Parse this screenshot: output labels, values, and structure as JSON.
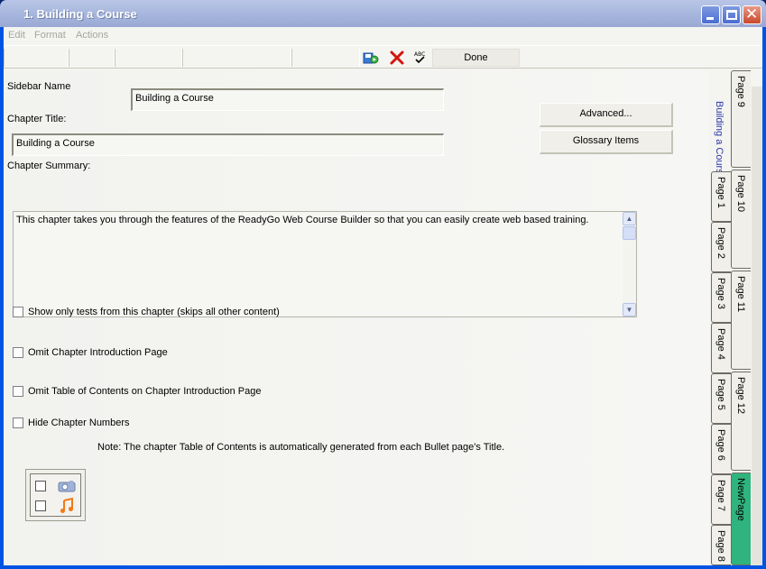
{
  "window": {
    "title": "1. Building a Course"
  },
  "menu": [
    "Edit",
    "Format",
    "Actions"
  ],
  "toolbar": {
    "done_label": "Done",
    "icons": [
      "save-run-icon",
      "delete-icon",
      "spell-check-icon"
    ]
  },
  "form": {
    "sidebar_name_label": "Sidebar Name",
    "sidebar_name_value": "Building a Course",
    "chapter_title_label": "Chapter Title:",
    "chapter_title_value": "Building a Course",
    "chapter_summary_label": "Chapter Summary:",
    "chapter_summary_value": "This chapter takes you through the features of the ReadyGo Web Course Builder so that you can easily create web based training.",
    "advanced_label": "Advanced...",
    "glossary_label": "Glossary Items"
  },
  "options": [
    {
      "label": "Show only tests from this chapter (skips all other content)",
      "checked": false
    },
    {
      "label": "Omit Chapter Introduction Page",
      "checked": false
    },
    {
      "label": "Omit Table of Contents on Chapter Introduction Page",
      "checked": false
    },
    {
      "label": "Hide Chapter Numbers",
      "checked": false
    }
  ],
  "note": "Note: The chapter Table of Contents is automatically generated from each Bullet page's Title.",
  "sidebar": {
    "course_title": "Building a Course",
    "tabs_left": [
      "Page 1",
      "Page 2",
      "Page 3",
      "Page 4",
      "Page 5",
      "Page 6",
      "Page 7",
      "Page 8"
    ],
    "tabs_right": [
      "Page 9",
      "Page 10",
      "Page 11",
      "Page 12",
      "NewPage"
    ],
    "active_tab": "NewPage",
    "active_color": "#2fb47e"
  }
}
